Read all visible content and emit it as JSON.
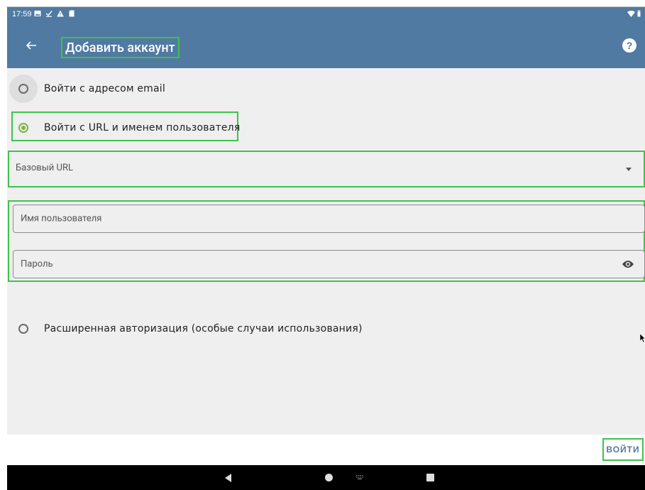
{
  "status_bar": {
    "time": "17:59",
    "icons": [
      "image-icon",
      "download-done-icon",
      "warning-icon",
      "sd-card-icon"
    ],
    "right_icons": [
      "wifi-icon",
      "battery-icon"
    ]
  },
  "app_bar": {
    "title": "Добавить аккаунт",
    "back_icon": "arrow-back-icon",
    "help_label": "?"
  },
  "options": {
    "email_label": "Войти с адресом email",
    "url_label": "Войти с URL и именем пользователя",
    "advanced_label": "Расширенная авторизация (особые случаи использования)",
    "selected": "url"
  },
  "fields": {
    "base_url_placeholder": "Базовый URL",
    "username_placeholder": "Имя пользователя",
    "password_placeholder": "Пароль"
  },
  "footer": {
    "login_label": "ВОЙТИ"
  },
  "colors": {
    "primary": "#507aa2",
    "accent": "#7cb342",
    "highlight": "#3fc24a"
  }
}
